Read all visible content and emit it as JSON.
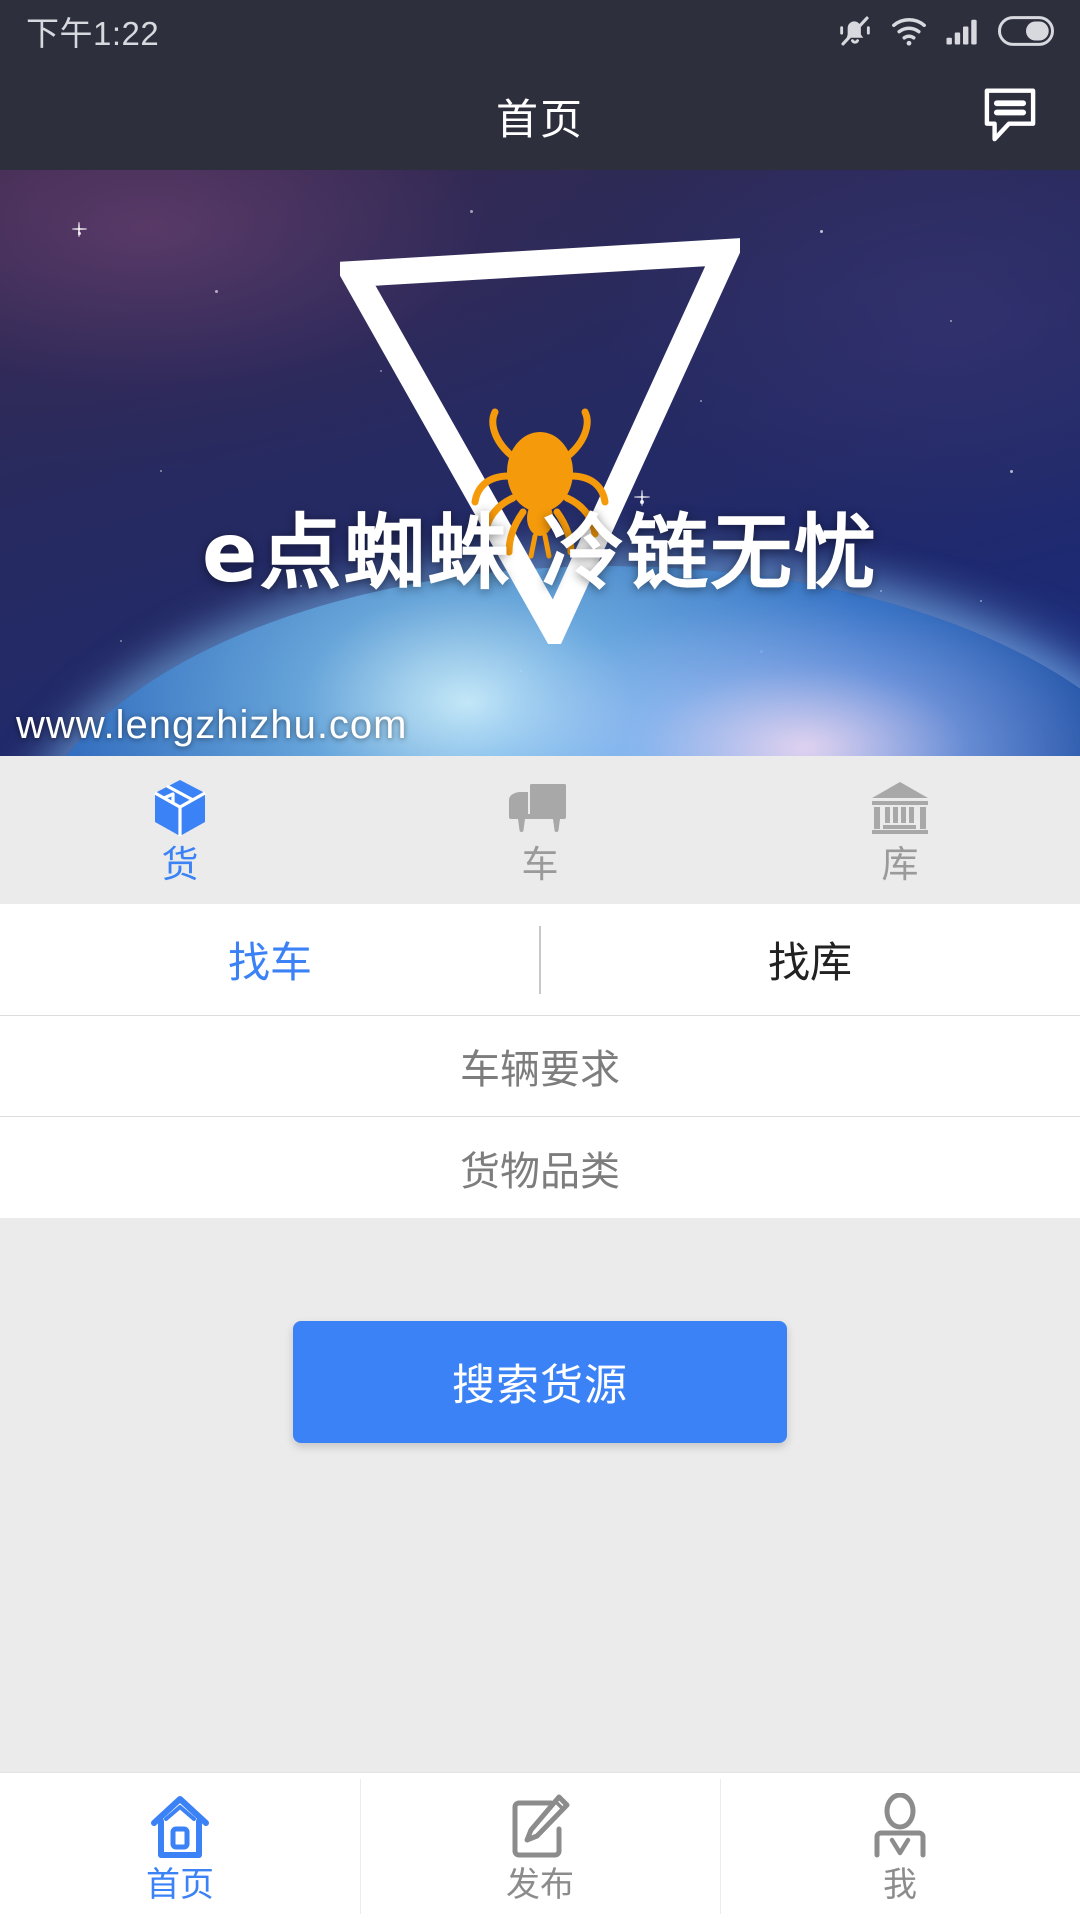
{
  "status_bar": {
    "time": "下午1:22",
    "icons": [
      "bell-muted-icon",
      "wifi-icon",
      "signal-icon",
      "battery-icon"
    ]
  },
  "header": {
    "title": "首页",
    "chat_icon": "chat-bubble-icon"
  },
  "banner": {
    "headline": "e点蜘蛛 冷链无忧",
    "url": "www.lengzhizhu.com",
    "logo_icon": "spider-triangle-logo",
    "accent_color": "#f59a0b"
  },
  "categories": {
    "items": [
      {
        "label": "货",
        "icon": "box-icon",
        "active": true
      },
      {
        "label": "车",
        "icon": "truck-icon",
        "active": false
      },
      {
        "label": "库",
        "icon": "warehouse-icon",
        "active": false
      }
    ],
    "active_color": "#3b82f6",
    "inactive_color": "#9a9a9a"
  },
  "tabs": {
    "items": [
      {
        "label": "找车",
        "active": true
      },
      {
        "label": "找库",
        "active": false
      }
    ]
  },
  "form": {
    "rows": [
      {
        "label": "车辆要求",
        "value": "",
        "placeholder": "车辆要求"
      },
      {
        "label": "货物品类",
        "value": "",
        "placeholder": "货物品类"
      }
    ]
  },
  "actions": {
    "search_label": "搜索货源",
    "search_color": "#3b82f6"
  },
  "bottom_nav": {
    "items": [
      {
        "label": "首页",
        "icon": "home-icon",
        "active": true
      },
      {
        "label": "发布",
        "icon": "publish-pencil-icon",
        "active": false
      },
      {
        "label": "我",
        "icon": "person-icon",
        "active": false
      }
    ],
    "active_color": "#3b82f6",
    "inactive_color": "#8c8c8c"
  }
}
